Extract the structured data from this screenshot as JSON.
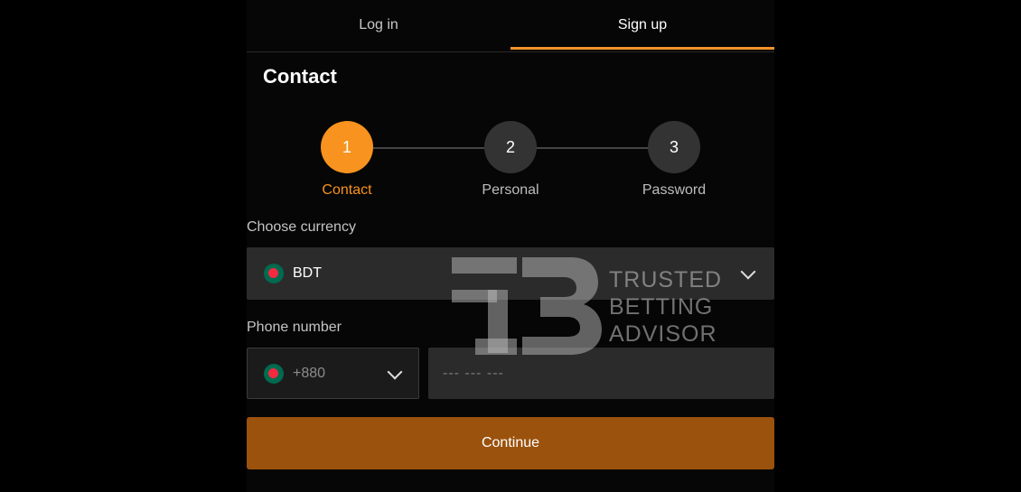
{
  "tabs": [
    {
      "label": "Log in",
      "active": false
    },
    {
      "label": "Sign up",
      "active": true
    }
  ],
  "title": "Contact",
  "steps": [
    {
      "number": "1",
      "label": "Contact",
      "active": true
    },
    {
      "number": "2",
      "label": "Personal",
      "active": false
    },
    {
      "number": "3",
      "label": "Password",
      "active": false
    }
  ],
  "currency": {
    "label": "Choose currency",
    "value": "BDT"
  },
  "phone": {
    "label": "Phone number",
    "code": "+880",
    "placeholder": "--- --- ---"
  },
  "continue_label": "Continue",
  "watermark": {
    "lines": [
      "TRUSTED",
      "BETTING",
      "ADVISOR"
    ]
  },
  "colors": {
    "accent": "#f7931e",
    "button": "#9b520c",
    "field": "#2b2b2b"
  }
}
